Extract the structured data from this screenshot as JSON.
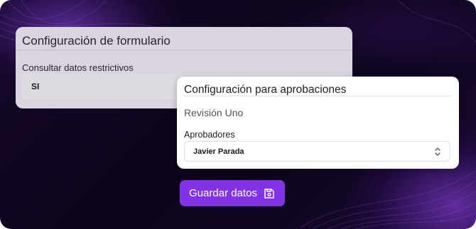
{
  "form_config": {
    "title": "Configuración de formulario",
    "restricted_label": "Consultar datos restrictivos",
    "restricted_value": "SI"
  },
  "approvals": {
    "title": "Configuración para aprobaciones",
    "subtitle": "Revisión Uno",
    "approvers_label": "Aprobadores",
    "approvers_value": "Javier Parada"
  },
  "save_button": {
    "label": "Guardar datos",
    "icon": "floppy-disk-icon"
  },
  "colors": {
    "accent": "#8233e6",
    "background": "#0c0519"
  }
}
